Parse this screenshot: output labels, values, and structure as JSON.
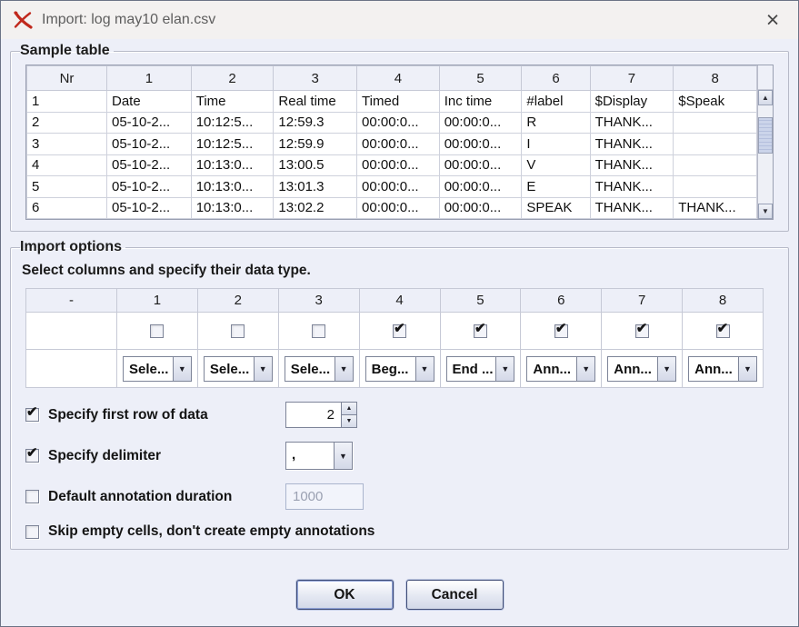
{
  "window": {
    "title": "Import: log may10 elan.csv"
  },
  "colors": {
    "logo_red": "#c0281c",
    "button_border": "#3e4b74"
  },
  "icons": {
    "close": "×",
    "scroll_up": "▲",
    "scroll_down": "▼",
    "combo_arrow": "▼",
    "check": "✔",
    "spinner_up": "▲",
    "spinner_down": "▼"
  },
  "sample_table": {
    "group_title": "Sample table",
    "headers": [
      "Nr",
      "1",
      "2",
      "3",
      "4",
      "5",
      "6",
      "7",
      "8"
    ],
    "rows": [
      [
        "1",
        "Date",
        "Time",
        "Real time",
        "Timed",
        "Inc time",
        "#label",
        "$Display",
        "$Speak"
      ],
      [
        "2",
        "05-10-2...",
        "10:12:5...",
        "12:59.3",
        "00:00:0...",
        "00:00:0...",
        "R",
        "THANK...",
        ""
      ],
      [
        "3",
        "05-10-2...",
        "10:12:5...",
        "12:59.9",
        "00:00:0...",
        "00:00:0...",
        "I",
        "THANK...",
        ""
      ],
      [
        "4",
        "05-10-2...",
        "10:13:0...",
        "13:00.5",
        "00:00:0...",
        "00:00:0...",
        "V",
        "THANK...",
        ""
      ],
      [
        "5",
        "05-10-2...",
        "10:13:0...",
        "13:01.3",
        "00:00:0...",
        "00:00:0...",
        "E",
        "THANK...",
        ""
      ],
      [
        "6",
        "05-10-2...",
        "10:13:0...",
        "13:02.2",
        "00:00:0...",
        "00:00:0...",
        "SPEAK",
        "THANK...",
        "THANK..."
      ]
    ]
  },
  "import_options": {
    "group_title": "Import options",
    "instruction": "Select columns and specify their data type.",
    "columns_table": {
      "headers": [
        "-",
        "1",
        "2",
        "3",
        "4",
        "5",
        "6",
        "7",
        "8"
      ],
      "checkboxes": [
        false,
        false,
        false,
        true,
        true,
        true,
        true,
        true
      ],
      "dropdowns": [
        "Sele...",
        "Sele...",
        "Sele...",
        "Beg...",
        "End ...",
        "Ann...",
        "Ann...",
        "Ann..."
      ]
    },
    "options": [
      {
        "label": "Specify first row of data",
        "checked": true,
        "control": "spinner",
        "value": "2"
      },
      {
        "label": "Specify delimiter",
        "checked": true,
        "control": "combo",
        "value": ","
      },
      {
        "label": "Default annotation duration",
        "checked": false,
        "control": "text",
        "value": "1000"
      },
      {
        "label": "Skip empty cells, don't create empty annotations",
        "checked": false,
        "control": "none",
        "value": ""
      }
    ]
  },
  "buttons": {
    "ok_label": "OK",
    "cancel_label": "Cancel"
  }
}
